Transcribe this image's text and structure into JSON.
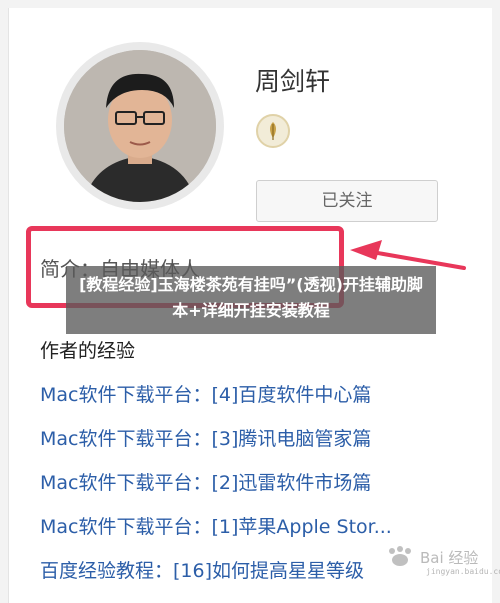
{
  "profile": {
    "name": "周剑轩",
    "badge_icon": "quill-medal-icon",
    "follow_label": "已关注",
    "intro": "简介：自由媒体人"
  },
  "overlay": {
    "caption": "[教程经验]玉海楼茶苑有挂吗”(透视)开挂辅助脚本+详细开挂安装教程"
  },
  "experience": {
    "title": "作者的经验",
    "items": [
      "Mac软件下载平台：[4]百度软件中心篇",
      "Mac软件下载平台：[3]腾讯电脑管家篇",
      "Mac软件下载平台：[2]迅雷软件市场篇",
      "Mac软件下载平台：[1]苹果Apple Stor...",
      "百度经验教程：[16]如何提高星星等级"
    ]
  },
  "watermark": {
    "brand": "Bai 经验",
    "url": "jingyan.baidu.com"
  },
  "colors": {
    "link": "#2c5ea8",
    "highlight": "#e8375a",
    "overlay": "#5a5a5a"
  }
}
